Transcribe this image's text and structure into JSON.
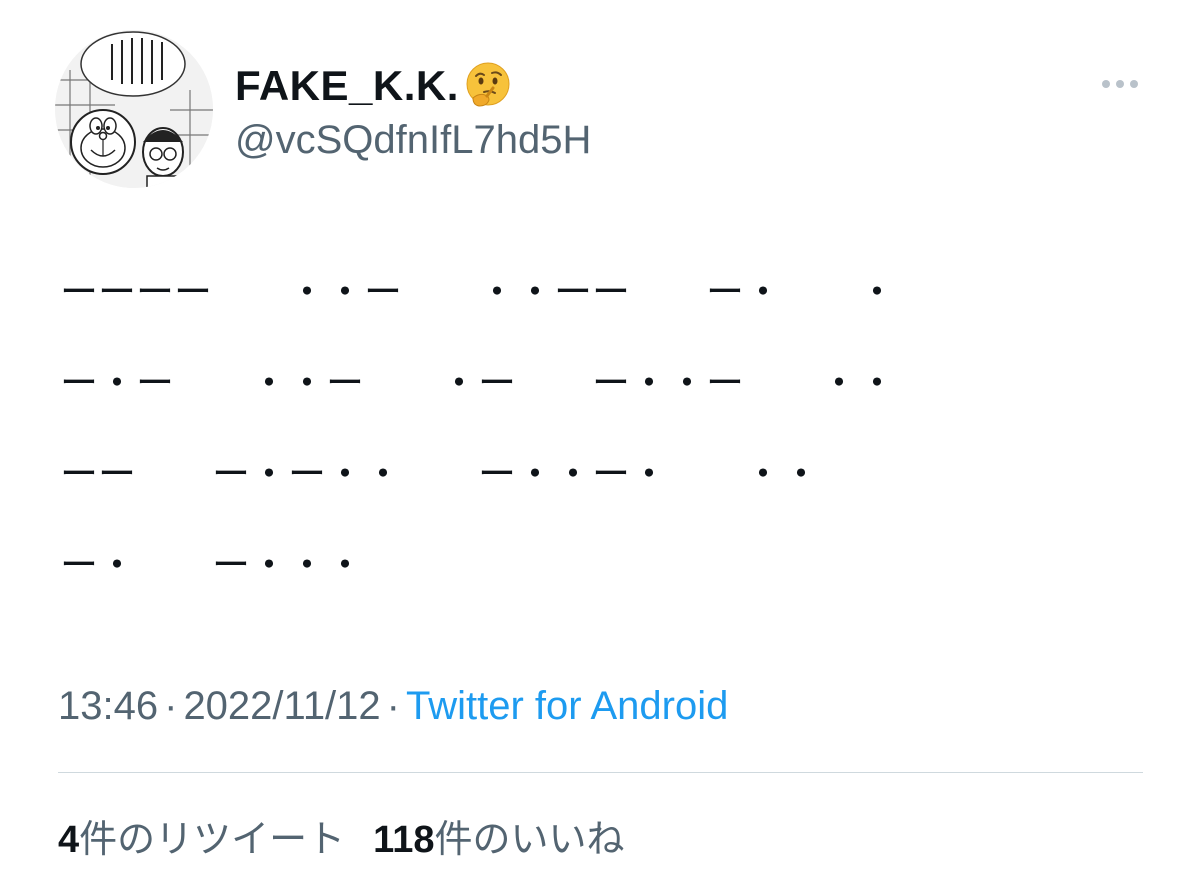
{
  "tweet": {
    "author": {
      "display_name": "FAKE_K.K.",
      "emoji_icon": "thinking-face-icon",
      "handle": "@vcSQdfnIfL7hd5H",
      "avatar_text": "こんなので引っかかるなんてツイッター民はちょろいね"
    },
    "body_lines": [
      "ーーーー　　・・ー　　・・ーー　　ー・　　・",
      "ー・ー　　・・ー　　・ー　　ー・・ー　　・・",
      "ーー　　ー・ー・・　　ー・・ー・　　・・",
      "ー・　　ー・・・"
    ],
    "time": "13:46",
    "separator": "·",
    "date": "2022/11/12",
    "source": "Twitter for Android",
    "stats": {
      "retweets_count": "4",
      "retweets_label": "件のリツイート",
      "likes_count": "118",
      "likes_label": "件のいいね"
    }
  },
  "colors": {
    "text": "#0f1419",
    "secondary": "#536471",
    "link": "#1d9bf0",
    "divider": "#cfd9de"
  }
}
